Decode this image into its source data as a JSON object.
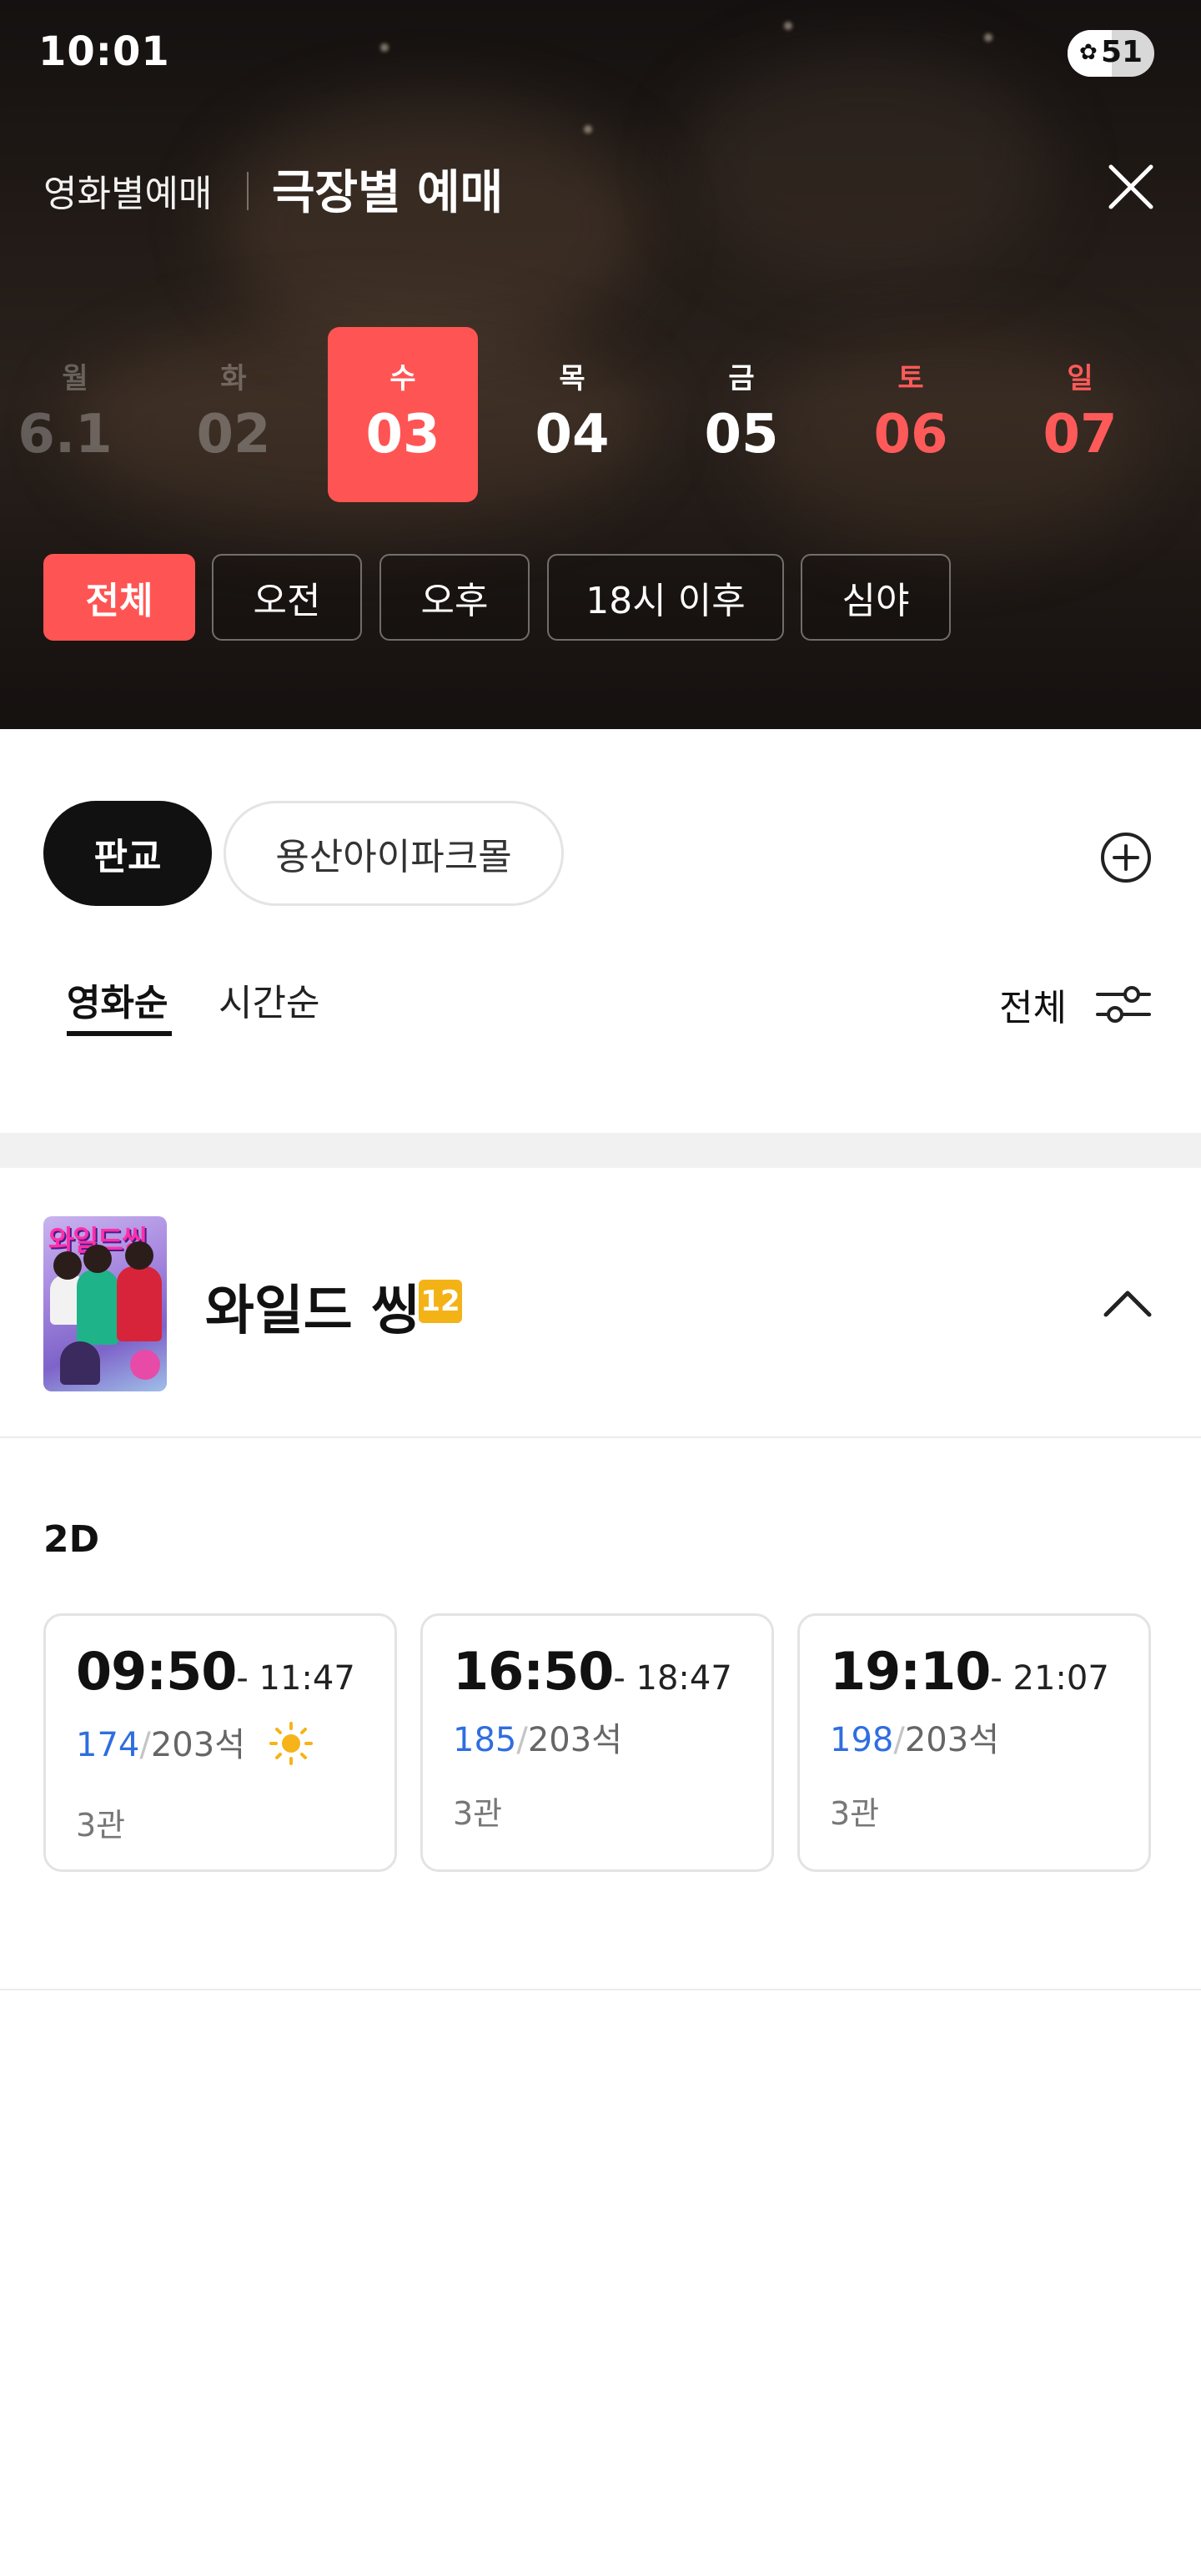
{
  "status_bar": {
    "time": "10:01",
    "battery_percent": "51",
    "battery_level": 0.51
  },
  "header": {
    "mode_tabs": [
      {
        "label": "영화별예매",
        "active": false
      },
      {
        "label": "극장별 예매",
        "active": true
      }
    ],
    "close_icon": "close-icon"
  },
  "date_picker": {
    "days": [
      {
        "dow": "월",
        "num": "6.1",
        "state": "past"
      },
      {
        "dow": "화",
        "num": "02",
        "state": "past"
      },
      {
        "dow": "수",
        "num": "03",
        "state": "selected"
      },
      {
        "dow": "목",
        "num": "04",
        "state": "normal"
      },
      {
        "dow": "금",
        "num": "05",
        "state": "normal"
      },
      {
        "dow": "토",
        "num": "06",
        "state": "weekend"
      },
      {
        "dow": "일",
        "num": "07",
        "state": "weekend"
      }
    ]
  },
  "time_filters": [
    {
      "label": "전체",
      "active": true
    },
    {
      "label": "오전",
      "active": false
    },
    {
      "label": "오후",
      "active": false
    },
    {
      "label": "18시 이후",
      "active": false
    },
    {
      "label": "심야",
      "active": false
    }
  ],
  "theaters": [
    {
      "label": "판교",
      "active": true
    },
    {
      "label": "용산아이파크몰",
      "active": false
    }
  ],
  "sort_tabs": [
    {
      "label": "영화순",
      "active": true
    },
    {
      "label": "시간순",
      "active": false
    }
  ],
  "sort_filter": {
    "label": "전체",
    "icon": "filter-sliders-icon"
  },
  "movie": {
    "poster_text": "와일드씽",
    "title": "와일드 씽",
    "rating": "12",
    "format": "2D",
    "showtimes": [
      {
        "start": "09:50",
        "end": "- 11:47",
        "available": "174",
        "slash": "/",
        "total": "203석",
        "screen": "3관",
        "morning_icon": true
      },
      {
        "start": "16:50",
        "end": "- 18:47",
        "available": "185",
        "slash": "/",
        "total": "203석",
        "screen": "3관",
        "morning_icon": false
      },
      {
        "start": "19:10",
        "end": "- 21:07",
        "available": "198",
        "slash": "/",
        "total": "203석",
        "screen": "3관",
        "morning_icon": false
      }
    ]
  },
  "colors": {
    "accent": "#ff5454",
    "weekend": "#ff5a5a",
    "seat_available": "#2f6ee0",
    "rating_12": "#f3b317",
    "chip_active": "#111111"
  }
}
